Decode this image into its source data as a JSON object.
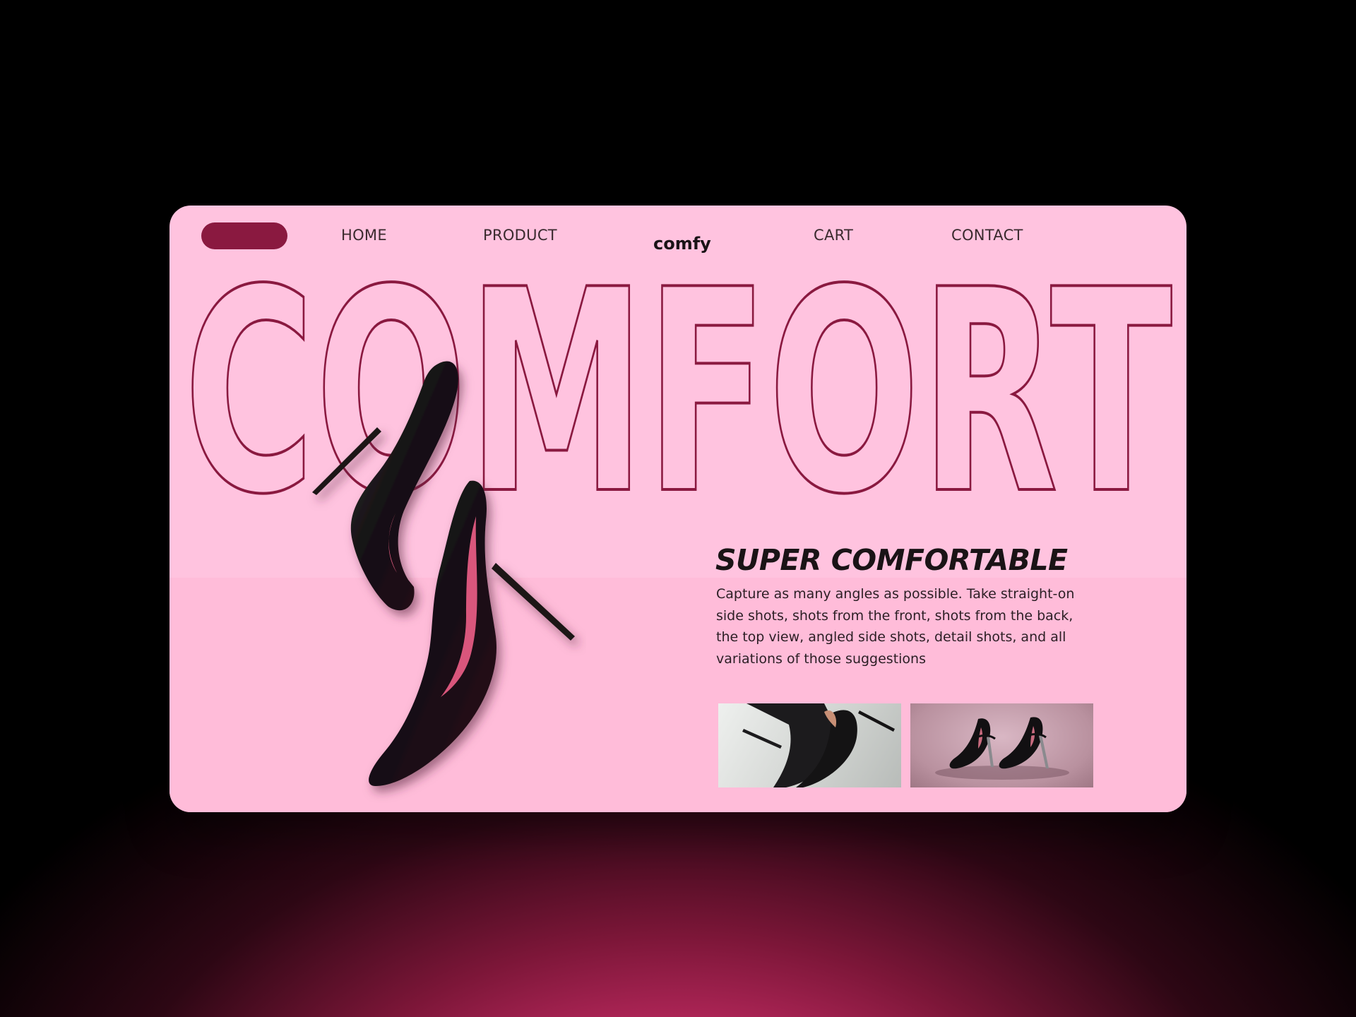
{
  "nav": {
    "links": [
      "HOME",
      "PRODUCT",
      "CART",
      "CONTACT"
    ],
    "logo_text": "comfy"
  },
  "hero": {
    "word": "COMFORT",
    "headline": "SUPER COMFORTABLE",
    "description": "Capture as many angles as possible. Take straight-on side shots, shots from the front, shots from the back, the top view, angled side shots, detail shots, and all variations of those suggestions"
  },
  "colors": {
    "card_background": "#ffc3df",
    "accent": "#8a1940",
    "outline_text": "#8a1940",
    "headline_text": "#1a1316"
  },
  "icons": {
    "hero_image": "black-stiletto-heels",
    "thumbnail_1": "black-suede-heels-photo",
    "thumbnail_2": "patent-heels-with-strap-photo"
  }
}
